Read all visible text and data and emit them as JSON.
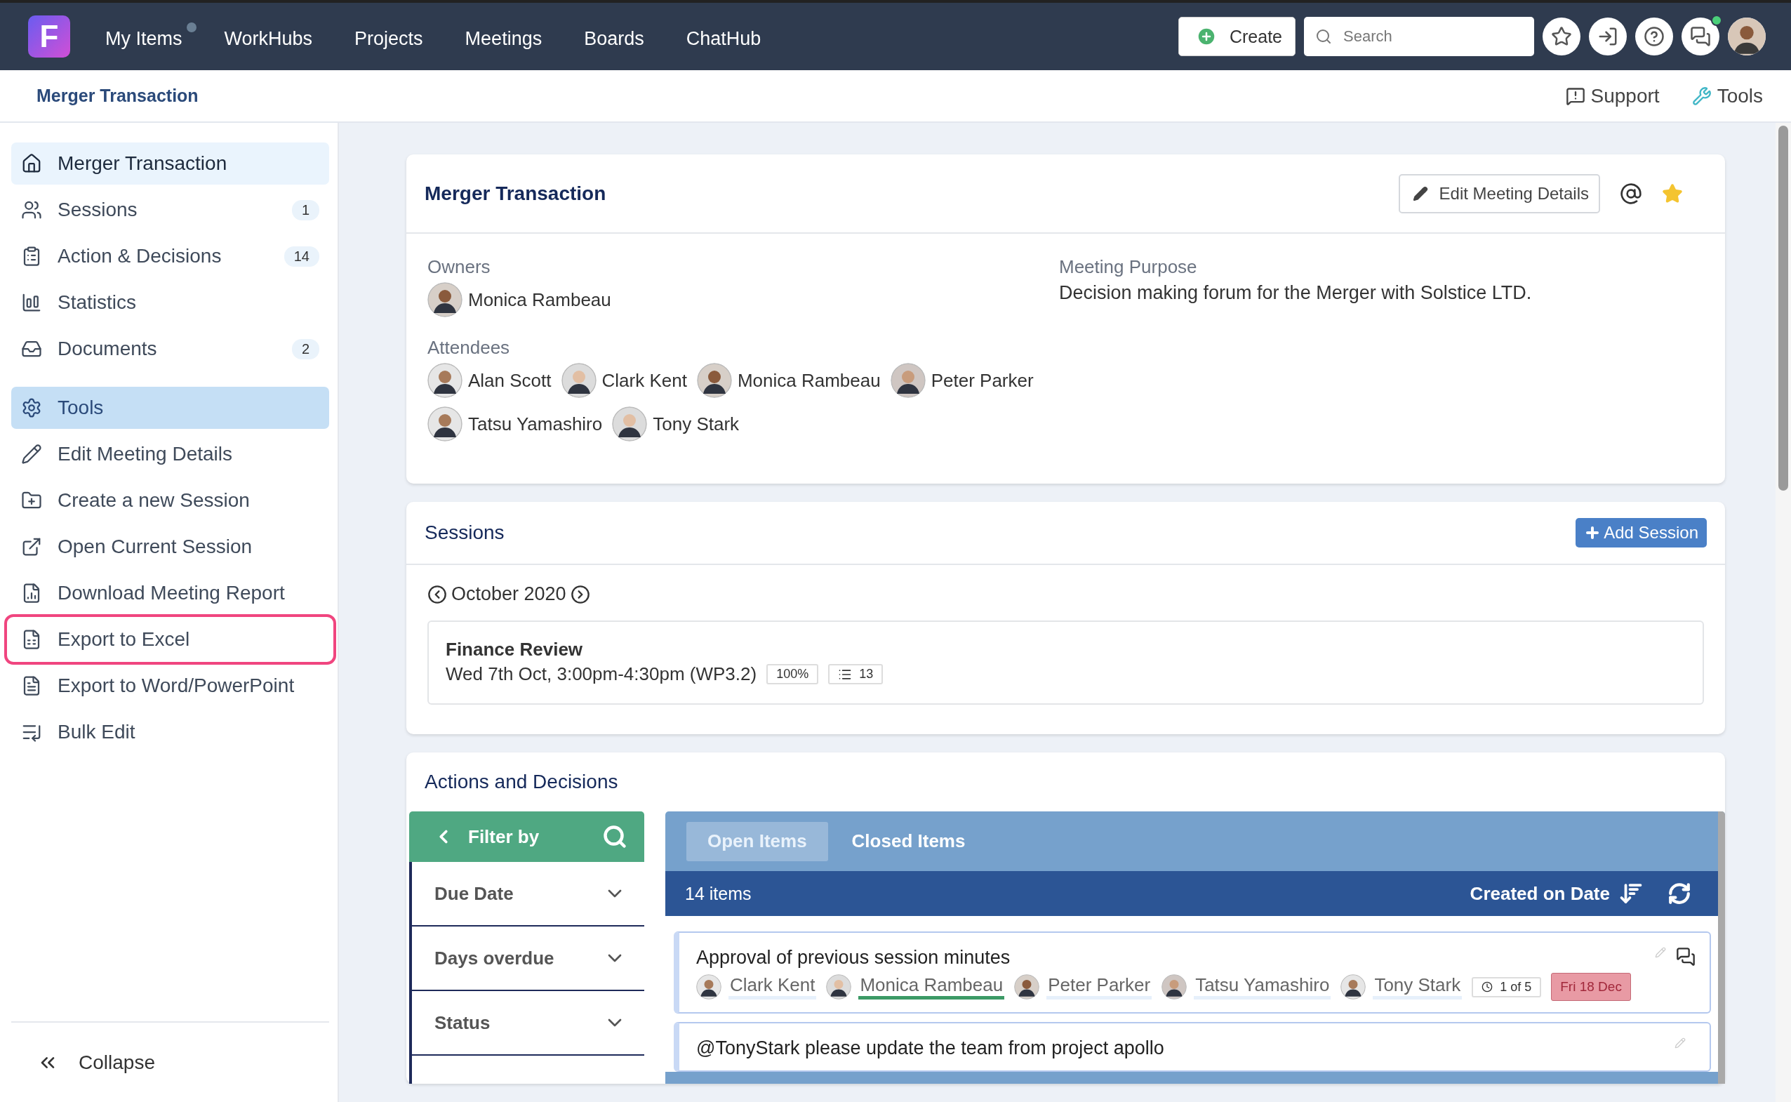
{
  "topbar": {
    "logo": "F",
    "nav": [
      {
        "label": "My Items",
        "badge": true
      },
      {
        "label": "WorkHubs",
        "badge": false
      },
      {
        "label": "Projects",
        "badge": false
      },
      {
        "label": "Meetings",
        "badge": false
      },
      {
        "label": "Boards",
        "badge": false
      },
      {
        "label": "ChatHub",
        "badge": false
      }
    ],
    "create": "Create",
    "search": {
      "placeholder": "Search"
    },
    "chat_unread": true
  },
  "breadcrumb": {
    "title": "Merger Transaction",
    "links": [
      "Support",
      "Tools"
    ]
  },
  "sidebar": {
    "items": [
      {
        "kind": "home",
        "label": "Merger Transaction",
        "selected": true
      },
      {
        "kind": "sessions",
        "label": "Sessions",
        "count": "1",
        "selected": false
      },
      {
        "kind": "actions",
        "label": "Action & Decisions",
        "count": "14",
        "selected": false
      },
      {
        "kind": "stats",
        "label": "Statistics",
        "selected": false
      },
      {
        "kind": "docs",
        "label": "Documents",
        "count": "2",
        "selected": false
      },
      {
        "kind": "tools",
        "label": "Tools",
        "selected": false
      },
      {
        "kind": "edit",
        "label": "Edit Meeting Details",
        "selected": false
      },
      {
        "kind": "new-session",
        "label": "Create a new Session",
        "selected": false
      },
      {
        "kind": "open",
        "label": "Open Current Session",
        "selected": false
      },
      {
        "kind": "report",
        "label": "Download Meeting Report",
        "selected": false
      },
      {
        "kind": "excel",
        "label": "Export to Excel",
        "selected": false,
        "outlined": true
      },
      {
        "kind": "word",
        "label": "Export to Word/PowerPoint",
        "selected": false
      },
      {
        "kind": "bulk",
        "label": "Bulk Edit",
        "selected": false
      }
    ],
    "collapse": "Collapse"
  },
  "meeting": {
    "title": "Merger Transaction",
    "edit_button": "Edit Meeting Details",
    "starred": true,
    "owners_label": "Owners",
    "owners": [
      "Monica Rambeau"
    ],
    "purpose_label": "Meeting Purpose",
    "purpose": "Decision making forum for the Merger with Solstice LTD.",
    "attendees_label": "Attendees",
    "attendees": [
      "Alan Scott",
      "Clark Kent",
      "Monica Rambeau",
      "Peter Parker",
      "Tatsu Yamashiro",
      "Tony Stark"
    ]
  },
  "sessions": {
    "title": "Sessions",
    "add_button": "Add Session",
    "month": "October 2020",
    "items": [
      {
        "title": "Finance Review",
        "when": "Wed 7th Oct, 3:00pm-4:30pm (WP3.2)",
        "progress": "100%",
        "count": "13"
      }
    ]
  },
  "actions": {
    "title": "Actions and Decisions",
    "filter": {
      "title": "Filter by",
      "fields": [
        "Due Date",
        "Days overdue",
        "Status"
      ]
    },
    "tabs": [
      {
        "label": "Open Items",
        "selected": true
      },
      {
        "label": "Closed Items",
        "selected": false
      }
    ],
    "count": "14 items",
    "sort": "Created on Date",
    "items": [
      {
        "title": "Approval of previous session minutes",
        "assignees": [
          {
            "name": "Clark Kent",
            "done": false
          },
          {
            "name": "Monica Rambeau",
            "done": true
          },
          {
            "name": "Peter Parker",
            "done": false
          },
          {
            "name": "Tatsu Yamashiro",
            "done": false
          },
          {
            "name": "Tony Stark",
            "done": false
          }
        ],
        "progress": "1 of 5",
        "due": "Fri 18 Dec"
      },
      {
        "title": "@TonyStark please update the team from project apollo"
      }
    ]
  }
}
